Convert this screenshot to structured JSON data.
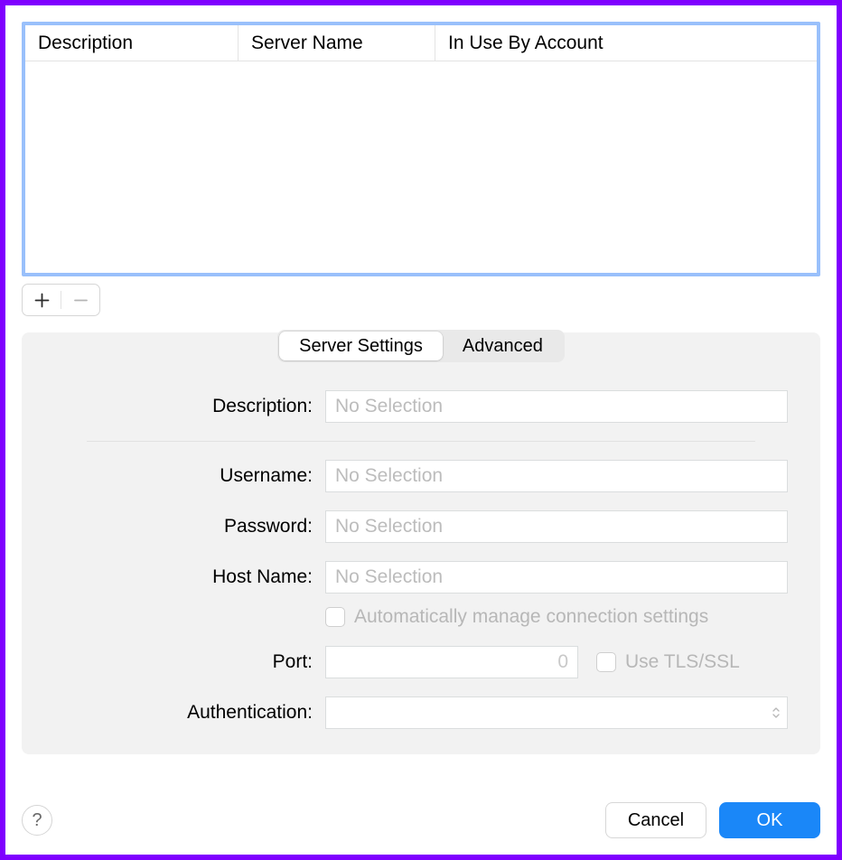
{
  "table": {
    "columns": {
      "description": "Description",
      "server_name": "Server Name",
      "in_use": "In Use By Account"
    },
    "rows": []
  },
  "list_controls": {
    "add": "+",
    "remove": "−"
  },
  "tabs": {
    "server_settings": "Server Settings",
    "advanced": "Advanced",
    "active": "server_settings"
  },
  "form": {
    "labels": {
      "description": "Description:",
      "username": "Username:",
      "password": "Password:",
      "host_name": "Host Name:",
      "port": "Port:",
      "authentication": "Authentication:"
    },
    "placeholders": {
      "no_selection": "No Selection"
    },
    "values": {
      "description": "",
      "username": "",
      "password": "",
      "host_name": "",
      "port": "0",
      "authentication": ""
    },
    "checkboxes": {
      "auto_manage": "Automatically manage connection settings",
      "use_tls": "Use TLS/SSL"
    }
  },
  "footer": {
    "help": "?",
    "cancel": "Cancel",
    "ok": "OK"
  },
  "colors": {
    "accent": "#1a87f8",
    "annotation": "#9b4dff",
    "frame": "#7f00ff",
    "focus_ring": "#99c0fb"
  }
}
